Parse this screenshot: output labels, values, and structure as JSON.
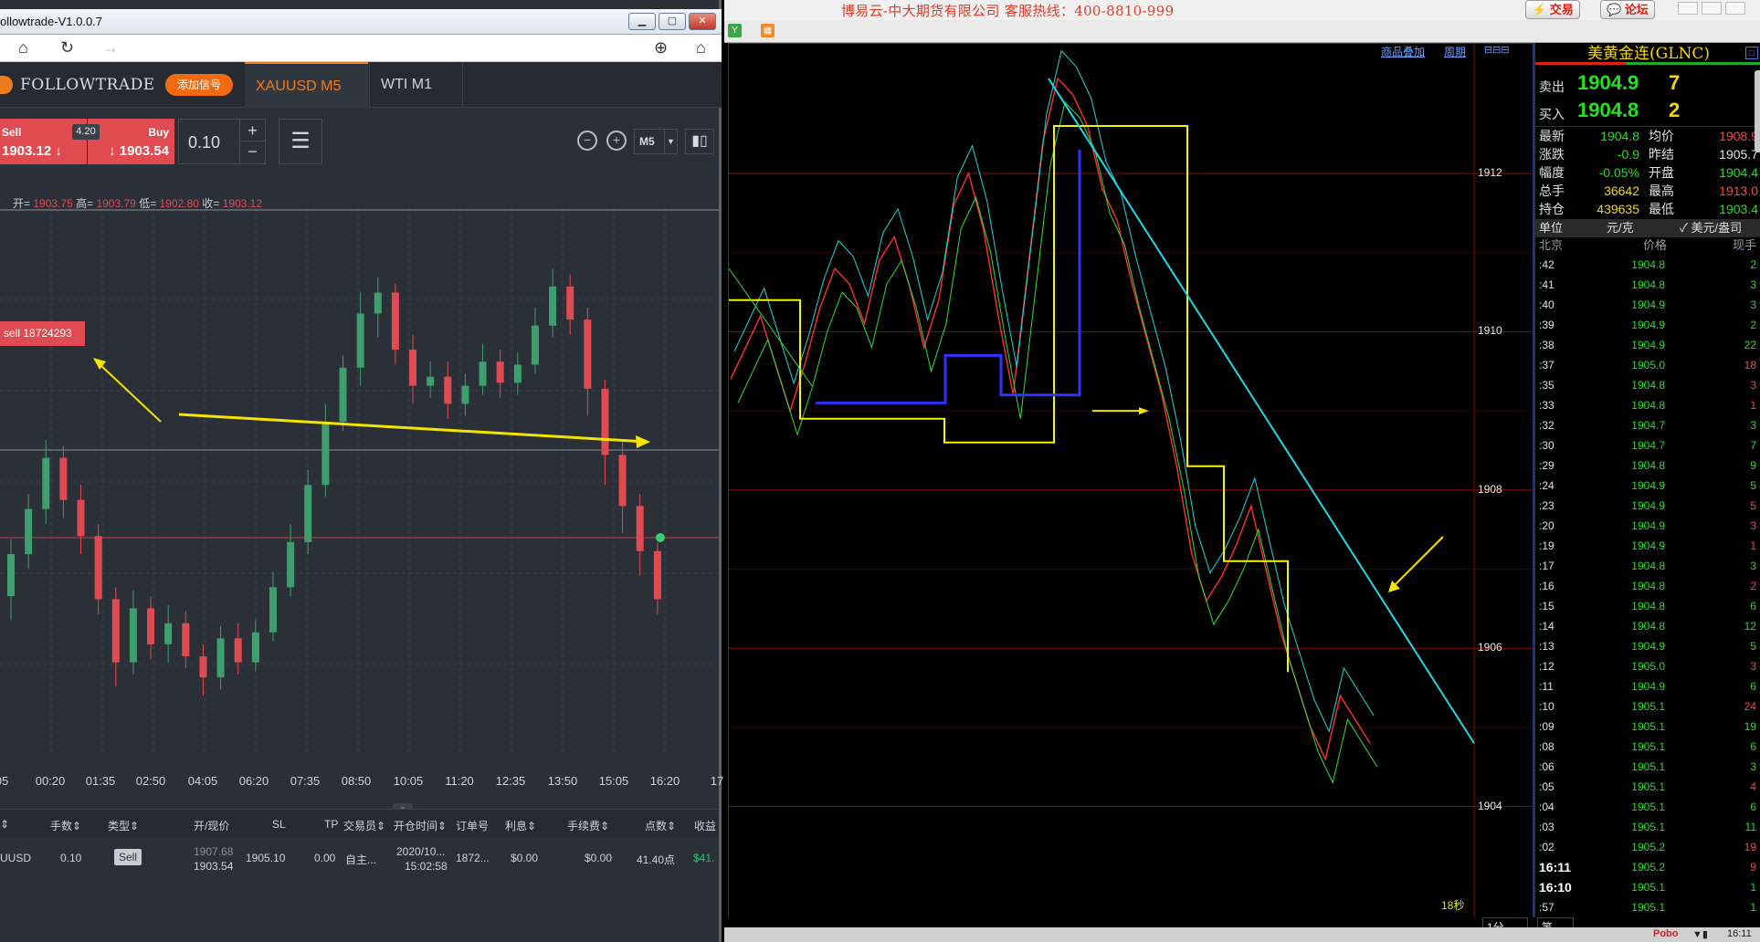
{
  "followtrade": {
    "window_title": "ollowtrade-V1.0.0.7",
    "brand": "FOLLOWTRADE",
    "add_signal": "添加信号",
    "tabs": [
      "XAUUSD M5",
      "WTI M1"
    ],
    "sell": {
      "label": "Sell",
      "price": "1903.12"
    },
    "buy": {
      "label": "Buy",
      "price": "1903.54"
    },
    "spread": "4.20",
    "lot": "0.10",
    "timeframe": "M5",
    "ohlc": {
      "open_label": "开=",
      "open": "1903.75",
      "high_label": "高=",
      "high": "1903.79",
      "low_label": "低=",
      "low": "1902.80",
      "close_label": "收=",
      "close": "1903.12"
    },
    "order_tag": "sell 18724293",
    "time_axis": [
      "05",
      "00:20",
      "01:35",
      "02:50",
      "04:05",
      "06:20",
      "07:35",
      "08:50",
      "10:05",
      "11:20",
      "12:35",
      "13:50",
      "15:05",
      "16:20",
      "17"
    ],
    "grid_headers": [
      "⇕",
      "手数⇕",
      "类型⇕",
      "开/现价",
      "SL",
      "TP",
      "交易员⇕",
      "开仓时间⇕",
      "订单号",
      "利息⇕",
      "手续费⇕",
      "点数⇕",
      "收益"
    ],
    "row": {
      "symbol": "UUSD",
      "lots": "0.10",
      "type": "Sell",
      "open_price": "1907.68",
      "current_price": "1903.54",
      "sl": "1905.10",
      "tp": "0.00",
      "trader": "自主...",
      "open_date": "2020/10...",
      "open_time": "15:02:58",
      "order_no": "1872...",
      "swap": "$0.00",
      "fee": "$0.00",
      "points": "41.40点",
      "profit": "$41."
    },
    "colors": {
      "sell": "#e04b52",
      "accent": "#f07c1d",
      "panel": "#2b3038"
    },
    "candles": [
      [
        1903.2,
        1904.6,
        1902.4,
        1905.1
      ],
      [
        1904.6,
        1906.1,
        1904.1,
        1906.6
      ],
      [
        1906.1,
        1907.8,
        1905.6,
        1908.4
      ],
      [
        1907.8,
        1906.4,
        1905.8,
        1908.2
      ],
      [
        1906.4,
        1905.2,
        1904.6,
        1906.9
      ],
      [
        1905.2,
        1903.1,
        1902.6,
        1905.6
      ],
      [
        1903.1,
        1901.0,
        1900.2,
        1903.5
      ],
      [
        1901.0,
        1902.8,
        1900.6,
        1903.4
      ],
      [
        1902.8,
        1901.6,
        1901.1,
        1903.2
      ],
      [
        1901.6,
        1902.3,
        1901.0,
        1902.9
      ],
      [
        1902.3,
        1901.2,
        1900.8,
        1902.7
      ],
      [
        1901.2,
        1900.5,
        1899.9,
        1901.6
      ],
      [
        1900.5,
        1901.8,
        1900.1,
        1902.2
      ],
      [
        1901.8,
        1901.0,
        1900.6,
        1902.3
      ],
      [
        1901.0,
        1902.0,
        1900.7,
        1902.4
      ],
      [
        1902.0,
        1903.5,
        1901.7,
        1904.0
      ],
      [
        1903.5,
        1905.0,
        1903.2,
        1905.6
      ],
      [
        1905.0,
        1906.9,
        1904.6,
        1907.4
      ],
      [
        1906.9,
        1909.0,
        1906.5,
        1909.6
      ],
      [
        1909.0,
        1910.8,
        1908.7,
        1911.2
      ],
      [
        1910.8,
        1912.6,
        1910.2,
        1913.3
      ],
      [
        1912.6,
        1913.3,
        1911.8,
        1913.8
      ],
      [
        1913.3,
        1911.4,
        1910.9,
        1913.6
      ],
      [
        1911.4,
        1910.2,
        1909.6,
        1911.9
      ],
      [
        1910.2,
        1910.5,
        1909.8,
        1911.0
      ],
      [
        1910.5,
        1909.6,
        1909.1,
        1911.0
      ],
      [
        1909.6,
        1910.2,
        1909.2,
        1910.6
      ],
      [
        1910.2,
        1911.0,
        1909.9,
        1911.6
      ],
      [
        1911.0,
        1910.3,
        1909.8,
        1911.4
      ],
      [
        1910.3,
        1910.9,
        1909.9,
        1911.3
      ],
      [
        1910.9,
        1912.2,
        1910.6,
        1912.8
      ],
      [
        1912.2,
        1913.5,
        1911.8,
        1914.1
      ],
      [
        1913.5,
        1912.4,
        1911.9,
        1913.9
      ],
      [
        1912.4,
        1910.1,
        1909.2,
        1912.8
      ],
      [
        1910.1,
        1907.9,
        1906.9,
        1910.4
      ],
      [
        1907.9,
        1906.2,
        1905.3,
        1908.4
      ],
      [
        1906.2,
        1904.7,
        1903.9,
        1906.6
      ],
      [
        1904.7,
        1903.1,
        1902.6,
        1905.0
      ]
    ]
  },
  "pobo": {
    "title": "博易云-中大期货有限公司   客服热线：400-8810-999",
    "trade_btn": "⚡ 交易",
    "forum_btn": "💬 论坛",
    "link_overlay": "商品叠加",
    "link_period": "周期",
    "price_labels": [
      "1912",
      "1910",
      "1908",
      "1906",
      "1904"
    ],
    "timer": "18秒",
    "period": "1分",
    "footer_tab": "笔",
    "status": "Pobo",
    "clock": "16:11",
    "ticker": "美黄金连(GLNC)",
    "sell_label": "卖出",
    "sell_price": "1904.9",
    "sell_qty": "7",
    "buy_label": "买入",
    "buy_price": "1904.8",
    "buy_qty": "2",
    "stats": [
      {
        "k": "最新",
        "v": "1904.8",
        "c": "#23e023",
        "k2": "均价",
        "v2": "1908.9",
        "c2": "#ff4444"
      },
      {
        "k": "涨跌",
        "v": "-0.9",
        "c": "#23e023",
        "k2": "昨结",
        "v2": "1905.7",
        "c2": "#e0e0e0"
      },
      {
        "k": "幅度",
        "v": "-0.05%",
        "c": "#23e023",
        "k2": "开盘",
        "v2": "1904.4",
        "c2": "#23e023"
      },
      {
        "k": "总手",
        "v": "36642",
        "c": "#f5d800",
        "k2": "最高",
        "v2": "1913.0",
        "c2": "#ff4444"
      },
      {
        "k": "持仓",
        "v": "439635",
        "c": "#f5d800",
        "k2": "最低",
        "v2": "1903.4",
        "c2": "#23e023"
      }
    ],
    "unit_label": "单位",
    "unit_rmb": "元/克",
    "unit_usd": "✓ 美元/盎司",
    "tick_head": {
      "time": "北京",
      "price": "价格",
      "vol": "现手"
    },
    "ticks": [
      {
        "t": ":42",
        "p": "1904.8",
        "v": "2",
        "c": "#23e023"
      },
      {
        "t": ":41",
        "p": "1904.8",
        "v": "3",
        "c": "#23e023"
      },
      {
        "t": ":40",
        "p": "1904.9",
        "v": "3",
        "c": "#23e023"
      },
      {
        "t": ":39",
        "p": "1904.9",
        "v": "2",
        "c": "#23e023"
      },
      {
        "t": ":38",
        "p": "1904.9",
        "v": "22",
        "c": "#23e023"
      },
      {
        "t": ":37",
        "p": "1905.0",
        "v": "18",
        "c": "#ff4444"
      },
      {
        "t": ":35",
        "p": "1904.8",
        "v": "3",
        "c": "#ff4444"
      },
      {
        "t": ":33",
        "p": "1904.8",
        "v": "1",
        "c": "#ff4444"
      },
      {
        "t": ":32",
        "p": "1904.7",
        "v": "3",
        "c": "#23e023"
      },
      {
        "t": ":30",
        "p": "1904.7",
        "v": "7",
        "c": "#23e023"
      },
      {
        "t": ":29",
        "p": "1904.8",
        "v": "9",
        "c": "#23e023"
      },
      {
        "t": ":24",
        "p": "1904.9",
        "v": "5",
        "c": "#23e023"
      },
      {
        "t": ":23",
        "p": "1904.9",
        "v": "5",
        "c": "#ff4444"
      },
      {
        "t": ":20",
        "p": "1904.9",
        "v": "3",
        "c": "#ff4444"
      },
      {
        "t": ":19",
        "p": "1904.9",
        "v": "1",
        "c": "#ff4444"
      },
      {
        "t": ":17",
        "p": "1904.8",
        "v": "3",
        "c": "#23e023"
      },
      {
        "t": ":16",
        "p": "1904.8",
        "v": "2",
        "c": "#ff4444"
      },
      {
        "t": ":15",
        "p": "1904.8",
        "v": "6",
        "c": "#23e023"
      },
      {
        "t": ":14",
        "p": "1904.8",
        "v": "12",
        "c": "#23e023"
      },
      {
        "t": ":13",
        "p": "1904.9",
        "v": "5",
        "c": "#23e023"
      },
      {
        "t": ":12",
        "p": "1905.0",
        "v": "3",
        "c": "#ff4444"
      },
      {
        "t": ":11",
        "p": "1904.9",
        "v": "6",
        "c": "#23e023"
      },
      {
        "t": ":10",
        "p": "1905.1",
        "v": "24",
        "c": "#ff4444"
      },
      {
        "t": ":09",
        "p": "1905.1",
        "v": "19",
        "c": "#23e023"
      },
      {
        "t": ":08",
        "p": "1905.1",
        "v": "6",
        "c": "#23e023"
      },
      {
        "t": ":06",
        "p": "1905.1",
        "v": "3",
        "c": "#23e023"
      },
      {
        "t": ":05",
        "p": "1905.1",
        "v": "4",
        "c": "#ff4444"
      },
      {
        "t": ":04",
        "p": "1905.1",
        "v": "6",
        "c": "#23e023"
      },
      {
        "t": ":03",
        "p": "1905.1",
        "v": "11",
        "c": "#23e023"
      },
      {
        "t": ":02",
        "p": "1905.2",
        "v": "19",
        "c": "#ff4444"
      },
      {
        "t": "16:11",
        "p": "1905.2",
        "v": "9",
        "c": "#ff4444",
        "big": true
      },
      {
        "t": "16:10",
        "p": "1905.1",
        "v": "1",
        "c": "#23e023",
        "big": true
      },
      {
        "t": ":57",
        "p": "1905.1",
        "v": "1",
        "c": "#23e023"
      }
    ],
    "price_path": [
      1909.4,
      1909.8,
      1910.2,
      1909.6,
      1909.0,
      1909.6,
      1910.3,
      1910.8,
      1910.6,
      1910.1,
      1910.9,
      1911.2,
      1910.6,
      1909.8,
      1910.4,
      1911.6,
      1912.0,
      1911.3,
      1910.2,
      1909.2,
      1910.8,
      1912.4,
      1913.2,
      1913.0,
      1912.6,
      1911.8,
      1911.4,
      1910.6,
      1909.9,
      1909.2,
      1908.3,
      1907.2,
      1906.6,
      1906.9,
      1907.3,
      1907.8,
      1907.0,
      1906.2,
      1905.6,
      1905.0,
      1904.6,
      1905.4,
      1905.1,
      1904.8
    ],
    "env_path": [
      [
        0,
        1910.4
      ],
      [
        78,
        1910.4
      ],
      [
        78,
        1908.9
      ],
      [
        236,
        1908.9
      ],
      [
        236,
        1908.6
      ],
      [
        356,
        1908.6
      ],
      [
        356,
        1912.6
      ],
      [
        502,
        1912.6
      ],
      [
        502,
        1908.3
      ],
      [
        542,
        1908.3
      ],
      [
        542,
        1907.1
      ],
      [
        612,
        1907.1
      ],
      [
        612,
        1905.7
      ]
    ],
    "support_path": [
      [
        95,
        1909.1
      ],
      [
        237,
        1909.1
      ],
      [
        237,
        1909.7
      ],
      [
        298,
        1909.7
      ],
      [
        298,
        1909.2
      ],
      [
        384,
        1909.2
      ],
      [
        384,
        1912.3
      ]
    ]
  }
}
